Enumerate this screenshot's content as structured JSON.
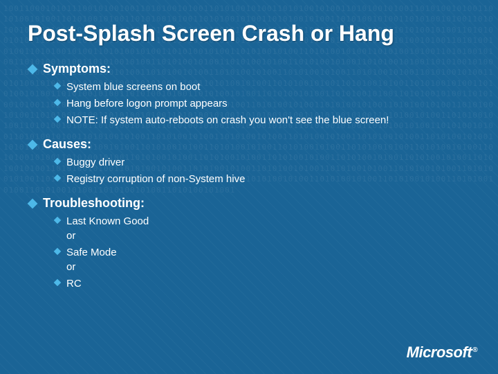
{
  "title": "Post-Splash Screen Crash or Hang",
  "sections": [
    {
      "label": "Symptoms:",
      "items": [
        "System blue screens on boot",
        "Hang before logon prompt appears",
        "NOTE: If system auto-reboots on crash you won't see the blue screen!"
      ]
    },
    {
      "label": "Causes:",
      "items": [
        "Buggy driver",
        "Registry corruption of non-System hive"
      ]
    },
    {
      "label": "Troubleshooting:",
      "items": [
        {
          "text": "Last Known Good",
          "sub": "or"
        },
        {
          "text": "Safe Mode",
          "sub": "or"
        },
        {
          "text": "RC",
          "sub": null
        }
      ]
    }
  ],
  "logo": {
    "text": "Microsoft",
    "trademark": "®"
  },
  "bg_numbers": "100110001010111001010010011010100101001101010010100110101001010011010100101001101010010100110101001010011010100101001101010010100110101001010011010100101001101010010100110101001010011010100101001101010010100110101001010011010100101001101010010100110101001010011010100101001101010"
}
